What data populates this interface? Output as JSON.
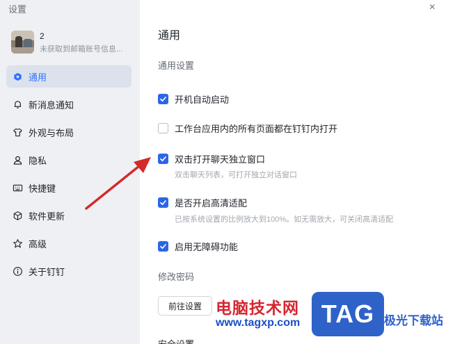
{
  "window": {
    "title": "设置",
    "close_icon": "×"
  },
  "profile": {
    "name": "2",
    "status": "未获取到邮箱账号信息..."
  },
  "sidebar": {
    "items": [
      {
        "label": "通用",
        "icon": "hexagon-icon",
        "active": true
      },
      {
        "label": "新消息通知",
        "icon": "bell-icon"
      },
      {
        "label": "外观与布局",
        "icon": "shirt-icon"
      },
      {
        "label": "隐私",
        "icon": "person-icon"
      },
      {
        "label": "快捷键",
        "icon": "keyboard-icon"
      },
      {
        "label": "软件更新",
        "icon": "cube-icon"
      },
      {
        "label": "高级",
        "icon": "star-icon"
      },
      {
        "label": "关于钉钉",
        "icon": "info-icon"
      }
    ]
  },
  "main": {
    "title": "通用",
    "section_general": "通用设置",
    "options": [
      {
        "label": "开机自动启动",
        "checked": true
      },
      {
        "label": "工作台应用内的所有页面都在钉钉内打开",
        "checked": false
      },
      {
        "label": "双击打开聊天独立窗口",
        "checked": true,
        "desc": "双击聊天列表，可打开独立对话窗口"
      },
      {
        "label": "是否开启高清适配",
        "checked": true,
        "desc": "已按系统设置的比例放大到100%。如无需放大，可关闭高清适配"
      },
      {
        "label": "启用无障碍功能",
        "checked": true
      }
    ],
    "section_password": "修改密码",
    "goto_button": "前往设置",
    "section_security": "安全设置"
  },
  "watermark": {
    "text": "电脑技术网",
    "url": "www.tagxp.com",
    "tag": "TAG",
    "site": "极光下载站"
  },
  "colors": {
    "accent": "#2b66e8",
    "arrow": "#d42a2a",
    "sidebar_bg": "#eef0f3"
  }
}
